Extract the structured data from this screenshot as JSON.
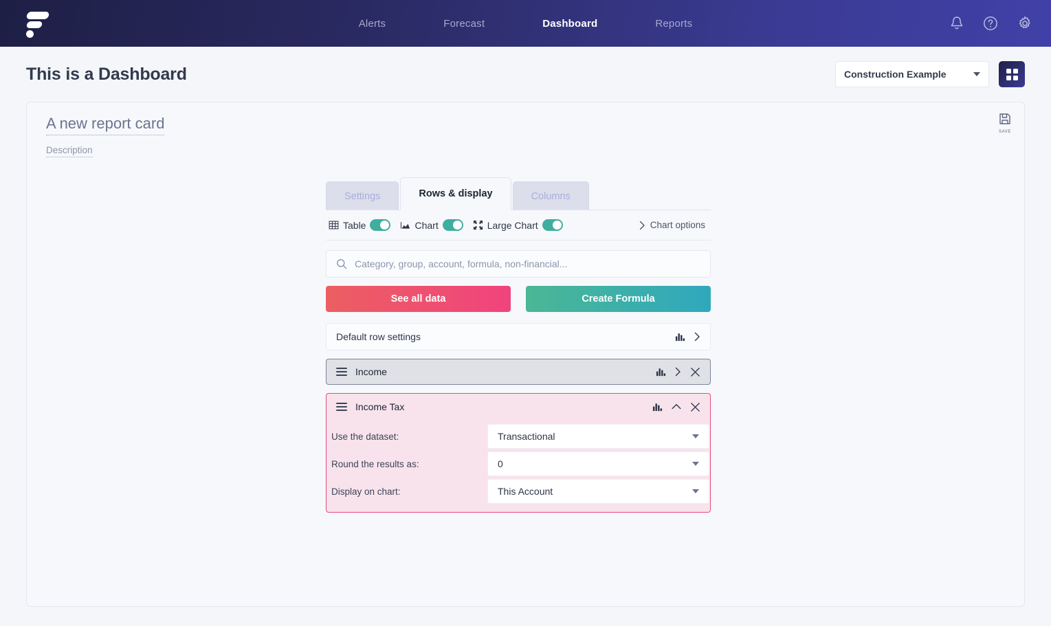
{
  "topnav": {
    "logo_name": "formula-logo",
    "items": [
      {
        "label": "Alerts",
        "active": false
      },
      {
        "label": "Forecast",
        "active": false
      },
      {
        "label": "Dashboard",
        "active": true
      },
      {
        "label": "Reports",
        "active": false
      }
    ],
    "icons": [
      "bell-icon",
      "help-circle-icon",
      "gear-icon"
    ]
  },
  "header": {
    "title": "This is a Dashboard",
    "entity_select": "Construction Example",
    "grid_button": "apps-grid-icon"
  },
  "card": {
    "title": "A new report card",
    "description": "Description",
    "save_label": "Save"
  },
  "panel": {
    "tabs": [
      {
        "label": "Settings",
        "active": false
      },
      {
        "label": "Rows & display",
        "active": true
      },
      {
        "label": "Columns",
        "active": false
      }
    ],
    "toggles": [
      {
        "label": "Table",
        "icon": "table-grid-icon",
        "on": true
      },
      {
        "label": "Chart",
        "icon": "area-chart-icon",
        "on": true
      },
      {
        "label": "Large Chart",
        "icon": "expand-arrows-icon",
        "on": true
      }
    ],
    "chart_options_label": "Chart options",
    "search": {
      "placeholder": "Category, group, account, formula, non-financial...",
      "value": ""
    },
    "buttons": {
      "see_all_data": "See all data",
      "create_formula": "Create Formula"
    },
    "rows": {
      "default_settings": "Default row settings",
      "income": "Income",
      "income_tax": "Income Tax"
    },
    "fields": [
      {
        "label": "Use the dataset:",
        "value": "Transactional"
      },
      {
        "label": "Round the results as:",
        "value": "0"
      },
      {
        "label": "Display on chart:",
        "value": "This Account"
      }
    ]
  },
  "colors": {
    "nav_gradient_start": "#1e1f45",
    "nav_gradient_end": "#4040a8",
    "toggle_on": "#3fae9e",
    "danger_button": "#ec5f61",
    "success_button": "#4bb795",
    "highlight_row_border": "#e8497e",
    "highlight_row_bg": "#f8e3ec"
  }
}
